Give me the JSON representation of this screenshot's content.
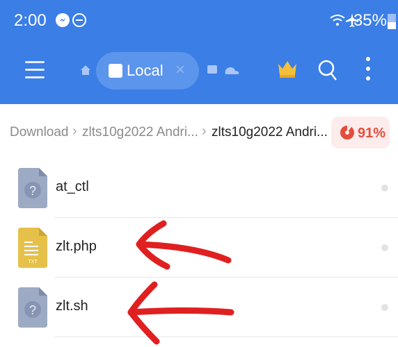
{
  "status_bar": {
    "time": "2:00",
    "icons": [
      "messenger-icon",
      "dnd-icon",
      "wifi-icon",
      "airplane-icon",
      "battery-icon"
    ],
    "battery": "35%"
  },
  "toolbar": {
    "tab_label": "Local",
    "close_label": "×",
    "icons": [
      "menu-icon",
      "home-icon",
      "local-storage-icon",
      "chat-icon",
      "cloud-icon",
      "crown-icon",
      "search-icon",
      "more-icon"
    ]
  },
  "breadcrumb": {
    "items": [
      "Download",
      "zlts10g2022 Andri...",
      "zlts10g2022 Andri..."
    ],
    "separator": "›",
    "storage_percent": "91%"
  },
  "files": [
    {
      "name": "at_ctl",
      "type": "unknown",
      "icon_mark": "?"
    },
    {
      "name": "zlt.php",
      "type": "text",
      "icon_mark": "TXT"
    },
    {
      "name": "zlt.sh",
      "type": "unknown",
      "icon_mark": "?"
    }
  ],
  "colors": {
    "header_bg": "#3a7ee6",
    "chip_bg": "#5b95ec",
    "storage_red": "#e54d3b",
    "txt_icon": "#e6c14a",
    "unknown_icon": "#9daac4",
    "annotation_red": "#e02020"
  }
}
